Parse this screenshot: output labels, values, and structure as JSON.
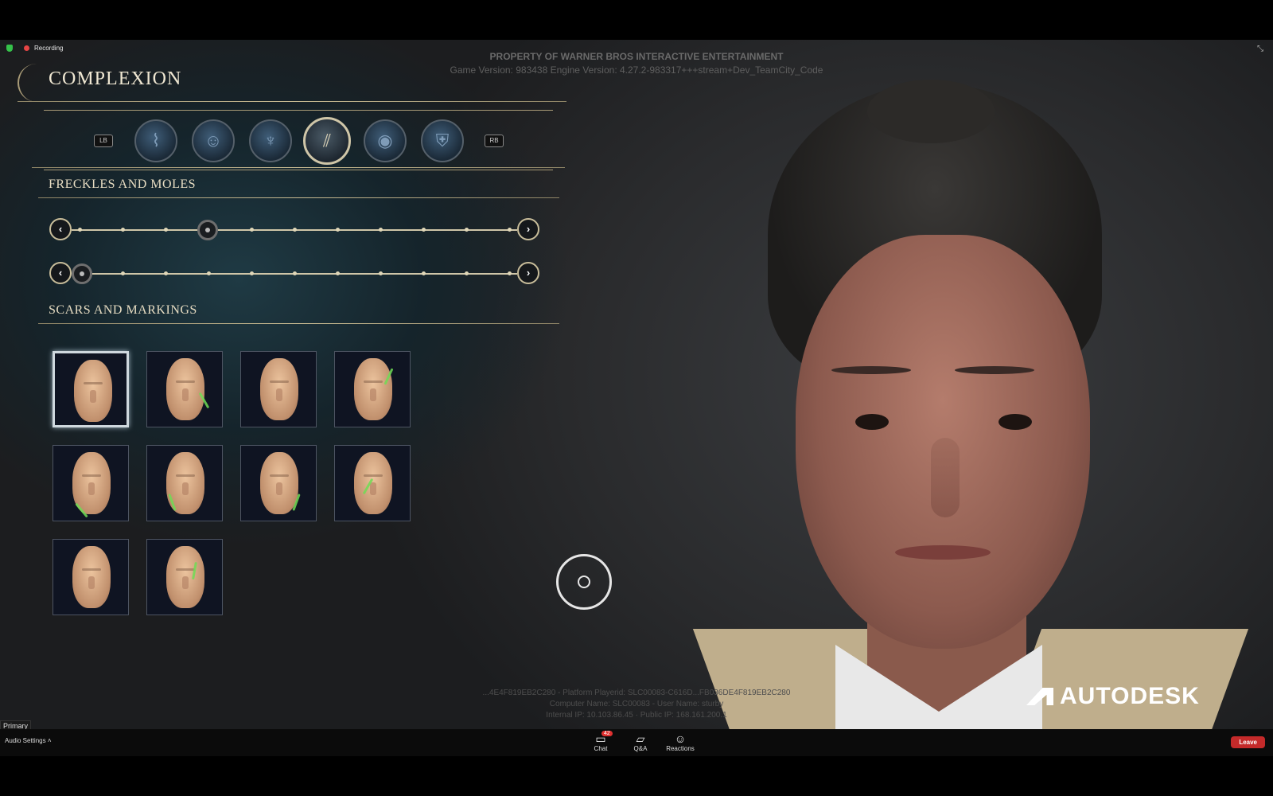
{
  "meeting": {
    "recording_label": "Recording",
    "primary_label": "Primary",
    "audio_settings": "Audio Settings",
    "toolbar": {
      "chat_label": "Chat",
      "chat_badge": "42",
      "qa_label": "Q&A",
      "reactions_label": "Reactions",
      "leave_label": "Leave"
    }
  },
  "watermark": {
    "line1": "PROPERTY OF WARNER BROS INTERACTIVE ENTERTAINMENT",
    "line2": "Game Version: 983438 Engine Version: 4.27.2-983317+++stream+Dev_TeamCity_Code"
  },
  "game": {
    "title": "COMPLEXION",
    "bumpers": {
      "left": "LB",
      "right": "RB"
    },
    "tabs": [
      {
        "icon": "wand-icon",
        "active": false
      },
      {
        "icon": "head-icon",
        "active": false
      },
      {
        "icon": "broom-icon",
        "active": false
      },
      {
        "icon": "scar-icon",
        "active": true
      },
      {
        "icon": "eye-icon",
        "active": false
      },
      {
        "icon": "house-crest-icon",
        "active": false
      }
    ],
    "section1": "FRECKLES AND MOLES",
    "section2": "SCARS AND MARKINGS",
    "sliders": [
      {
        "name": "freckles",
        "value_step": 2,
        "steps": 10
      },
      {
        "name": "moles",
        "value_step": 0,
        "steps": 10
      }
    ],
    "selected_marking": 1,
    "marking_count": 10
  },
  "debug": {
    "line1": "...4E4F819EB2C280 - Platform Playerid: SLC00083-C616D...FB036DE4F819EB2C280",
    "line2": "Computer Name: SLC00083 - User Name: sturby",
    "line3": "Internal IP: 10.103.86.45 · Public IP: 168.161.200.1"
  },
  "branding": {
    "autodesk": "AUTODESK"
  },
  "colors": {
    "accent_gold": "#cfc6a8",
    "leave_red": "#c42a2a",
    "marking_green": "#6fdc55"
  }
}
